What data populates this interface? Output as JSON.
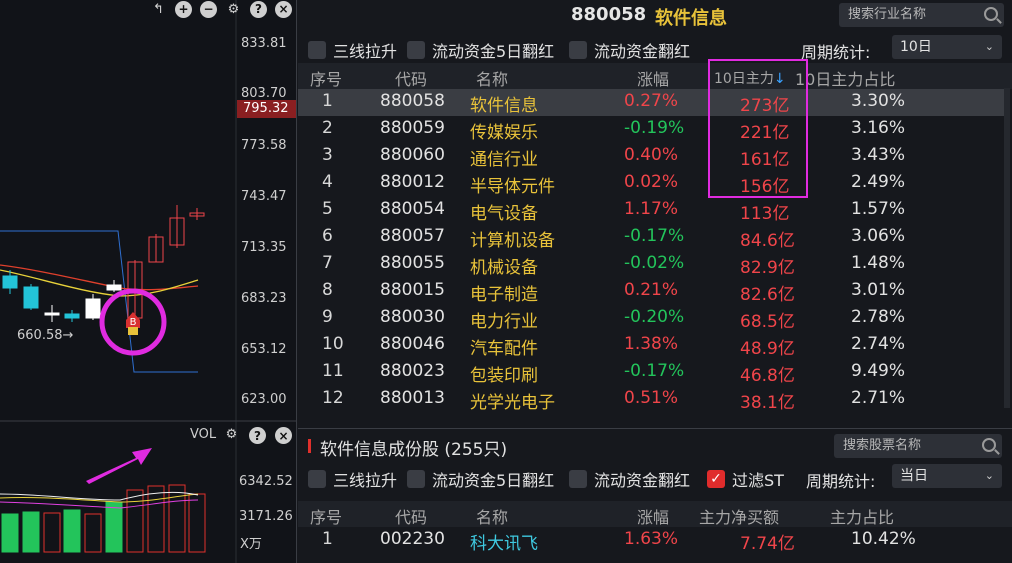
{
  "chart": {
    "price_ticks": [
      "833.81",
      "803.70",
      "773.58",
      "743.47",
      "713.35",
      "683.23",
      "653.12",
      "623.00"
    ],
    "current_price": "795.32",
    "low_annotation": "660.58→",
    "buy_badge": "B",
    "vol_title": "VOL",
    "vol_ticks": [
      "6342.52",
      "3171.26"
    ],
    "vol_unit": "X万",
    "colors": {
      "up": "#f0454a",
      "down": "#23c4d8",
      "highlight": "#e02be0",
      "vol_up": "#e0302c",
      "vol_down": "#23c45b"
    }
  },
  "header": {
    "code": "880058",
    "name": "软件信息",
    "search_placeholder": "搜索行业名称"
  },
  "filters_top": {
    "options": [
      "三线拉升",
      "流动资金5日翻红",
      "流动资金翻红"
    ],
    "period_label": "周期统计:",
    "period_value": "10日"
  },
  "industry_table": {
    "columns": [
      "序号",
      "代码",
      "名称",
      "涨幅",
      "10日主力",
      "10日主力占比"
    ],
    "sort_indicator": "↓",
    "rows": [
      {
        "idx": "1",
        "code": "880058",
        "name": "软件信息",
        "change": "0.27%",
        "amount": "273亿",
        "ratio": "3.30%",
        "dir": "up"
      },
      {
        "idx": "2",
        "code": "880059",
        "name": "传媒娱乐",
        "change": "-0.19%",
        "amount": "221亿",
        "ratio": "3.16%",
        "dir": "down"
      },
      {
        "idx": "3",
        "code": "880060",
        "name": "通信行业",
        "change": "0.40%",
        "amount": "161亿",
        "ratio": "3.43%",
        "dir": "up"
      },
      {
        "idx": "4",
        "code": "880012",
        "name": "半导体元件",
        "change": "0.02%",
        "amount": "156亿",
        "ratio": "2.49%",
        "dir": "up"
      },
      {
        "idx": "5",
        "code": "880054",
        "name": "电气设备",
        "change": "1.17%",
        "amount": "113亿",
        "ratio": "1.57%",
        "dir": "up"
      },
      {
        "idx": "6",
        "code": "880057",
        "name": "计算机设备",
        "change": "-0.17%",
        "amount": "84.6亿",
        "ratio": "3.06%",
        "dir": "down"
      },
      {
        "idx": "7",
        "code": "880055",
        "name": "机械设备",
        "change": "-0.02%",
        "amount": "82.9亿",
        "ratio": "1.48%",
        "dir": "down"
      },
      {
        "idx": "8",
        "code": "880015",
        "name": "电子制造",
        "change": "0.21%",
        "amount": "82.6亿",
        "ratio": "3.01%",
        "dir": "up"
      },
      {
        "idx": "9",
        "code": "880030",
        "name": "电力行业",
        "change": "-0.20%",
        "amount": "68.5亿",
        "ratio": "2.78%",
        "dir": "down"
      },
      {
        "idx": "10",
        "code": "880046",
        "name": "汽车配件",
        "change": "1.38%",
        "amount": "48.9亿",
        "ratio": "2.74%",
        "dir": "up"
      },
      {
        "idx": "11",
        "code": "880023",
        "name": "包装印刷",
        "change": "-0.17%",
        "amount": "46.8亿",
        "ratio": "9.49%",
        "dir": "down"
      },
      {
        "idx": "12",
        "code": "880013",
        "name": "光学光电子",
        "change": "0.51%",
        "amount": "38.1亿",
        "ratio": "2.71%",
        "dir": "up"
      }
    ]
  },
  "components": {
    "title": "软件信息成份股",
    "count": "(255只)",
    "search_placeholder": "搜索股票名称",
    "filters": [
      "三线拉升",
      "流动资金5日翻红",
      "流动资金翻红",
      "过滤ST"
    ],
    "filter_checked_icon": "check-icon",
    "period_label": "周期统计:",
    "period_value": "当日",
    "columns": [
      "序号",
      "代码",
      "名称",
      "涨幅",
      "主力净买额",
      "主力占比"
    ],
    "rows": [
      {
        "idx": "1",
        "code": "002230",
        "name": "科大讯飞",
        "change": "1.63%",
        "amount": "7.74亿",
        "ratio": "10.42%"
      }
    ]
  }
}
